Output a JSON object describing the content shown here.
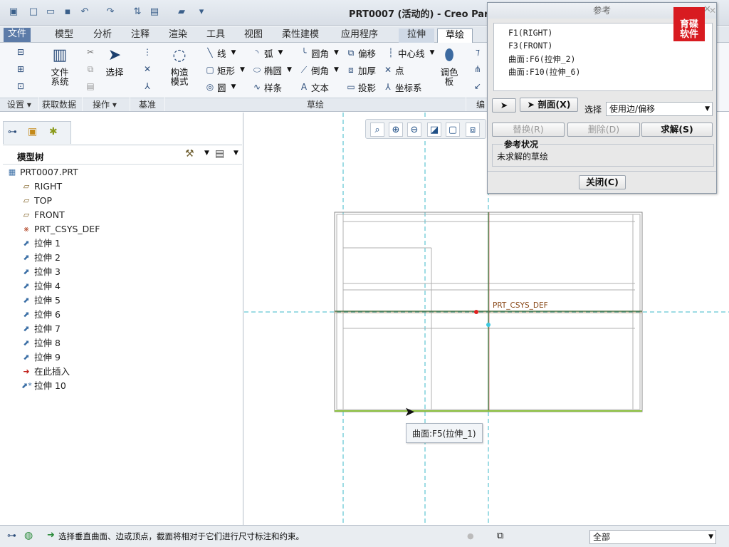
{
  "window": {
    "title": "PRT0007 (活动的) - Creo Parar"
  },
  "tabs": [
    "文件",
    "模型",
    "分析",
    "注释",
    "渲染",
    "工具",
    "视图",
    "柔性建模",
    "应用程序",
    "拉伸",
    "草绘"
  ],
  "ribbon": {
    "file_system": "文件\n系统",
    "select": "选择",
    "construct_mode": "构造\n模式",
    "palette": "调色\n板",
    "line": "线",
    "arc": "弧",
    "fillet": "圆角",
    "offset": "偏移",
    "centerline": "中心线",
    "rectangle": "矩形",
    "ellipse": "椭圆",
    "chamfer": "倒角",
    "thicken": "加厚",
    "point": "点",
    "circle": "圆",
    "spline": "样条",
    "text": "文本",
    "project": "投影",
    "coordsys": "坐标系"
  },
  "groups": {
    "settings": "设置",
    "get_data": "获取数据",
    "operations": "操作",
    "datum": "基准",
    "sketch": "草绘",
    "edit_partial": "编"
  },
  "model_tree": {
    "header": "模型树",
    "items": [
      "PRT0007.PRT",
      "RIGHT",
      "TOP",
      "FRONT",
      "PRT_CSYS_DEF",
      "拉伸 1",
      "拉伸 2",
      "拉伸 3",
      "拉伸 4",
      "拉伸 5",
      "拉伸 6",
      "拉伸 7",
      "拉伸 8",
      "拉伸 9",
      "在此插入",
      "拉伸 10"
    ]
  },
  "canvas": {
    "csys_label": "PRT_CSYS_DEF",
    "tooltip": "曲面:F5(拉伸_1)"
  },
  "references_dialog": {
    "title": "参考",
    "items": [
      "F1(RIGHT)",
      "F3(FRONT)",
      "曲面:F6(拉伸_2)",
      "曲面:F10(拉伸_6)"
    ],
    "section_btn": "剖面(X)",
    "select_label": "选择",
    "select_value": "使用边/偏移",
    "replace": "替换(R)",
    "delete": "删除(D)",
    "solve": "求解(S)",
    "status_title": "参考状况",
    "status_text": "未求解的草绘",
    "close": "关闭(C)"
  },
  "watermark": "育碟\n软件",
  "status": {
    "message": "选择垂直曲面、边或顶点，截面将相对于它们进行尺寸标注和约束。",
    "filter": "全部"
  }
}
